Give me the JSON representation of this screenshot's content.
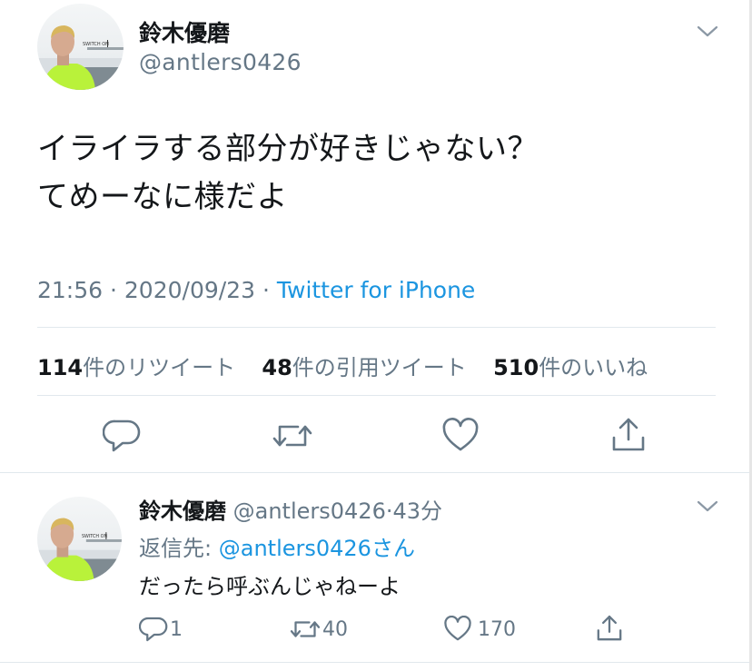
{
  "tweet": {
    "author_name": "鈴木優磨",
    "author_handle": "@antlers0426",
    "text_line1": "イライラする部分が好きじゃない？",
    "text_line2": "てめーなに様だよ",
    "time": "21:56",
    "date": "2020/09/23",
    "dot": "·",
    "source": "Twitter for iPhone",
    "stats": {
      "retweets_count": "114",
      "retweets_label": "件のリツイート",
      "quotes_count": "48",
      "quotes_label": "件の引用ツイート",
      "likes_count": "510",
      "likes_label": "件のいいね"
    },
    "actions": [
      "reply-icon",
      "retweet-icon",
      "heart-icon",
      "share-icon"
    ]
  },
  "reply": {
    "author_name": "鈴木優磨",
    "author_handle": "@antlers0426",
    "dot": "·",
    "age": "43分",
    "replying_prefix": "返信先:",
    "replying_to": "@antlers0426さん",
    "text": "だったら呼ぶんじゃねーよ",
    "reply_count": "1",
    "retweet_count": "40",
    "like_count": "170"
  },
  "avatar_text": "SWITCH ON",
  "colors": {
    "link": "#1b95e0",
    "secondary": "#657786",
    "divider": "#e1e8ed",
    "jersey": "#b9f23a"
  }
}
